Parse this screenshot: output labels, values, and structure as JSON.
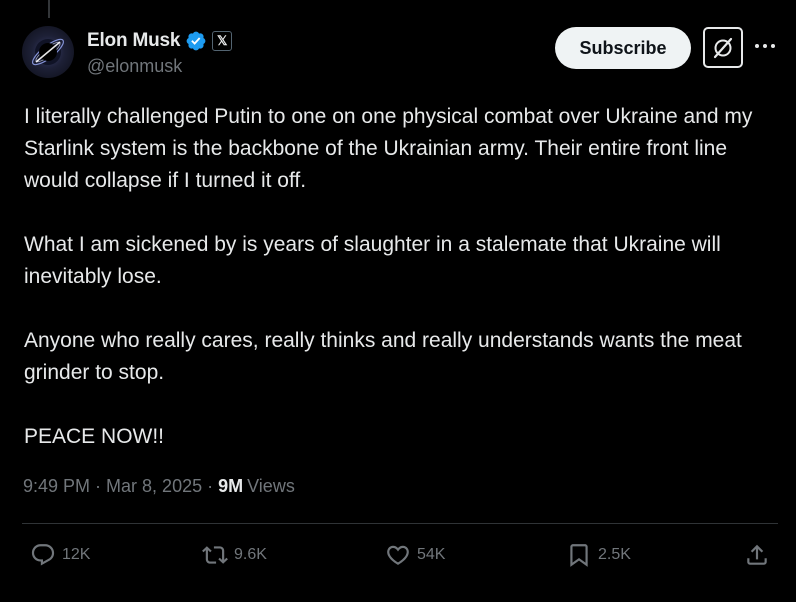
{
  "author": {
    "display_name": "Elon Musk",
    "handle": "@elonmusk",
    "verified_color": "#1d9bf0",
    "affiliation_badge": "𝕏"
  },
  "header": {
    "subscribe_label": "Subscribe"
  },
  "tweet": {
    "paragraphs": [
      "I literally challenged Putin to one on one physical combat over Ukraine and my Starlink system is the backbone of the Ukrainian army. Their entire front line would collapse if I turned it off.",
      "What I am sickened by is years of slaughter in a stalemate that Ukraine will inevitably lose.",
      "Anyone who really cares, really thinks and really understands wants the meat grinder to stop.",
      "PEACE NOW!!"
    ],
    "time": "9:49 PM",
    "date": "Mar 8, 2025",
    "views_count": "9M",
    "views_label": "Views",
    "separator": "·"
  },
  "actions": {
    "replies": "12K",
    "reposts": "9.6K",
    "likes": "54K",
    "bookmarks": "2.5K"
  },
  "colors": {
    "background": "#000000",
    "text_primary": "#e7e9ea",
    "text_secondary": "#71767b",
    "divider": "#2f3336"
  }
}
